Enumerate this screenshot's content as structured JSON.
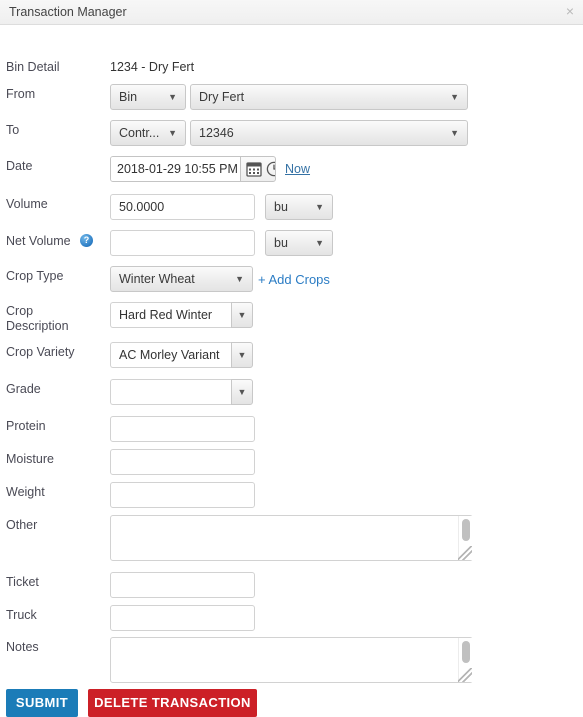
{
  "window": {
    "title": "Transaction Manager",
    "close_icon": "close-icon",
    "close_glyph": "×"
  },
  "colors": {
    "link": "#2b7cc4",
    "submit_bg": "#1b7cb8",
    "delete_bg": "#cc2027",
    "help_icon": "#2b7cc4"
  },
  "form": {
    "bin_detail": {
      "label": "Bin Detail",
      "value": "1234 - Dry Fert"
    },
    "from": {
      "label": "From",
      "type_value": "Bin",
      "source_value": "Dry Fert"
    },
    "to": {
      "label": "To",
      "type_value": "Contr...",
      "source_value": "12346"
    },
    "date": {
      "label": "Date",
      "value": "2018-01-29 10:55 PM",
      "calendar_icon": "calendar-icon",
      "clock_icon": "clock-icon",
      "now_label": "Now"
    },
    "volume": {
      "label": "Volume",
      "value": "50.0000",
      "unit": "bu"
    },
    "net_volume": {
      "label": "Net Volume",
      "value": "",
      "unit": "bu",
      "help_icon": "help-icon",
      "help_glyph": "?"
    },
    "crop_type": {
      "label": "Crop Type",
      "value": "Winter Wheat",
      "add_crops_label": "+ Add Crops"
    },
    "crop_description": {
      "label": "Crop Description",
      "value": "Hard Red Winter"
    },
    "crop_variety": {
      "label": "Crop Variety",
      "value": "AC Morley Variant"
    },
    "grade": {
      "label": "Grade",
      "value": ""
    },
    "protein": {
      "label": "Protein",
      "value": ""
    },
    "moisture": {
      "label": "Moisture",
      "value": ""
    },
    "weight": {
      "label": "Weight",
      "value": ""
    },
    "other": {
      "label": "Other",
      "value": ""
    },
    "ticket": {
      "label": "Ticket",
      "value": ""
    },
    "truck": {
      "label": "Truck",
      "value": ""
    },
    "notes": {
      "label": "Notes",
      "value": ""
    }
  },
  "actions": {
    "submit_label": "SUBMIT",
    "delete_label": "DELETE TRANSACTION"
  },
  "caret_glyph": "▼"
}
